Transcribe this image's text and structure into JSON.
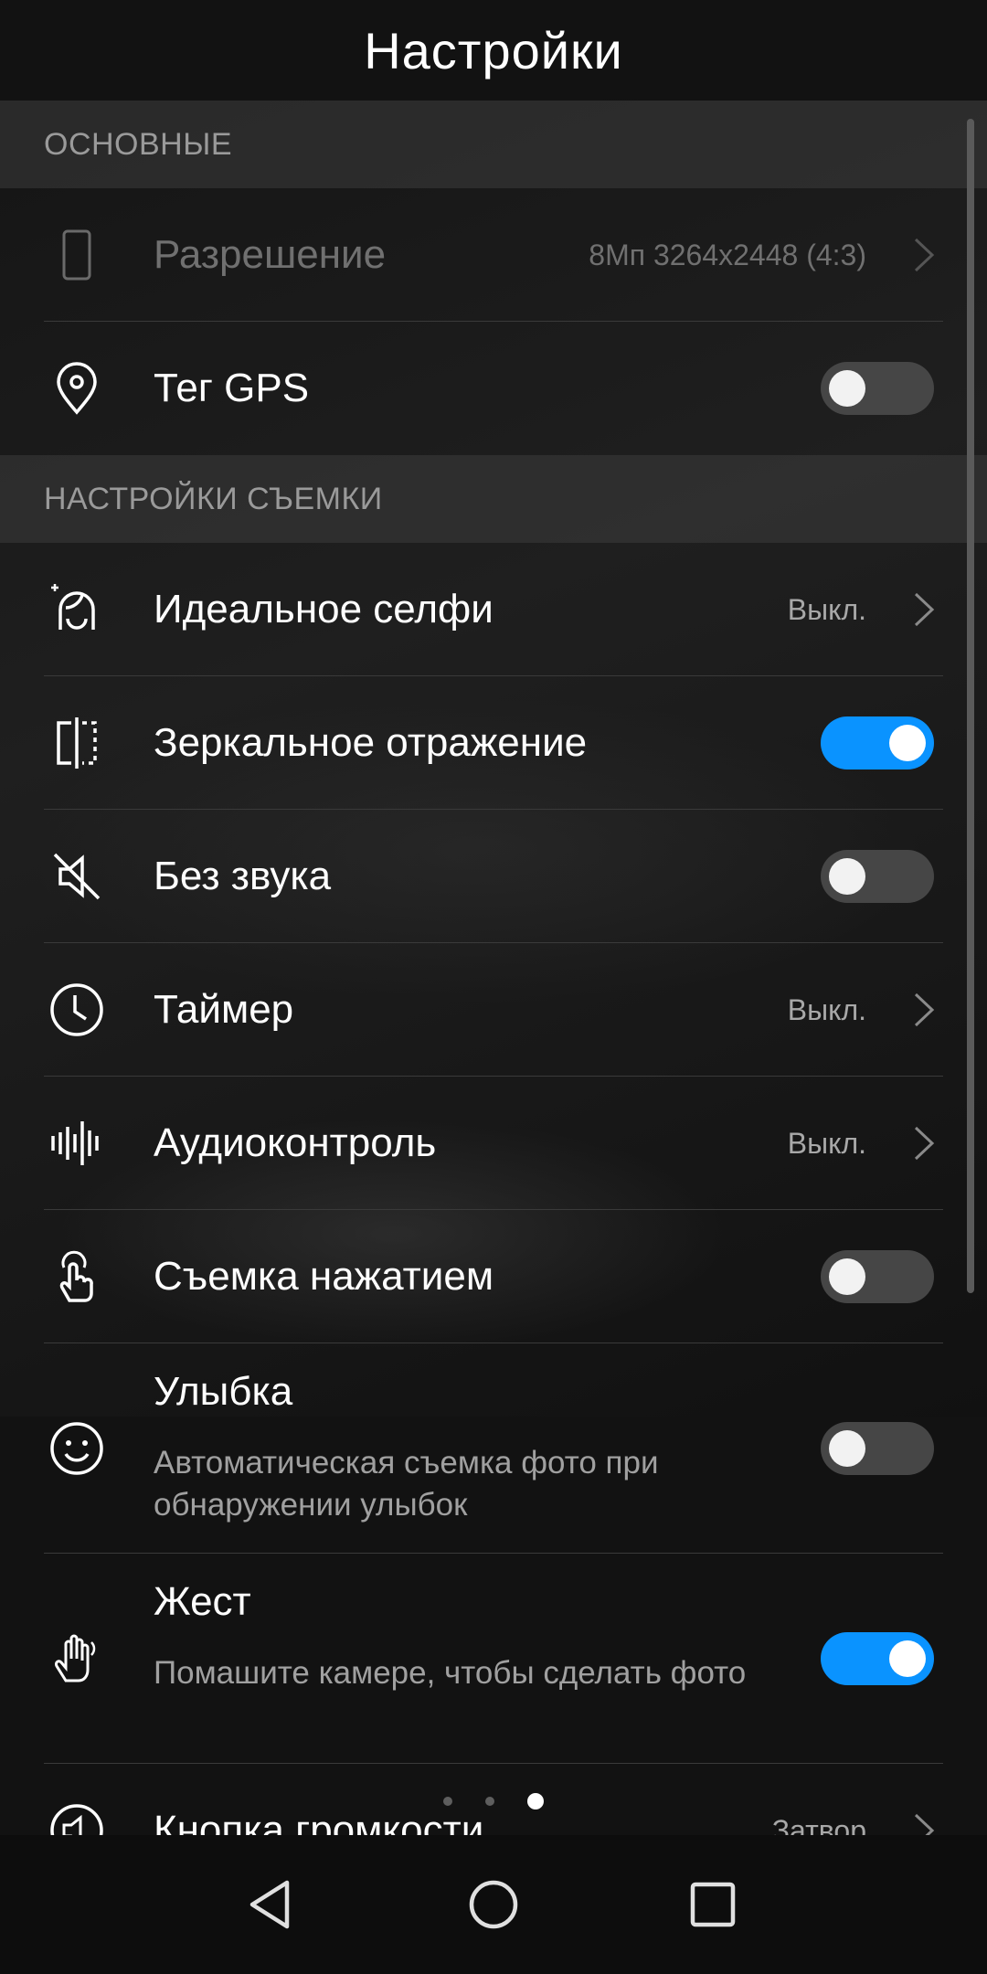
{
  "header": {
    "title": "Настройки"
  },
  "sections": {
    "basic": {
      "label": "ОСНОВНЫЕ"
    },
    "shooting": {
      "label": "НАСТРОЙКИ СЪЕМКИ"
    }
  },
  "rows": {
    "resolution": {
      "label": "Разрешение",
      "value": "8Мп 3264x2448 (4:3)",
      "icon": "phone-outline-icon",
      "enabled": false
    },
    "gps": {
      "label": "Тег GPS",
      "icon": "location-pin-icon",
      "toggle": false
    },
    "selfie": {
      "label": "Идеальное селфи",
      "value": "Выкл.",
      "icon": "face-sparkle-icon"
    },
    "mirror": {
      "label": "Зеркальное отражение",
      "icon": "mirror-icon",
      "toggle": true
    },
    "mute": {
      "label": "Без звука",
      "icon": "speaker-muted-icon",
      "toggle": false
    },
    "timer": {
      "label": "Таймер",
      "value": "Выкл.",
      "icon": "clock-icon"
    },
    "audio": {
      "label": "Аудиоконтроль",
      "value": "Выкл.",
      "icon": "sound-wave-icon"
    },
    "touch": {
      "label": "Съемка нажатием",
      "icon": "touch-finger-icon",
      "toggle": false
    },
    "smile": {
      "label": "Улыбка",
      "desc": "Автоматическая съемка фото при обнаружении улыбок",
      "icon": "smile-icon",
      "toggle": false
    },
    "gesture": {
      "label": "Жест",
      "desc": "Помашите камере, чтобы сделать фото",
      "icon": "hand-wave-icon",
      "toggle": true
    },
    "volume": {
      "label": "Кнопка громкости",
      "value": "Затвор",
      "icon": "speaker-icon"
    }
  },
  "pager": {
    "count": 3,
    "active": 3
  },
  "colors": {
    "accent": "#0a93ff",
    "background": "#121212",
    "toggle_off": "#464646"
  }
}
